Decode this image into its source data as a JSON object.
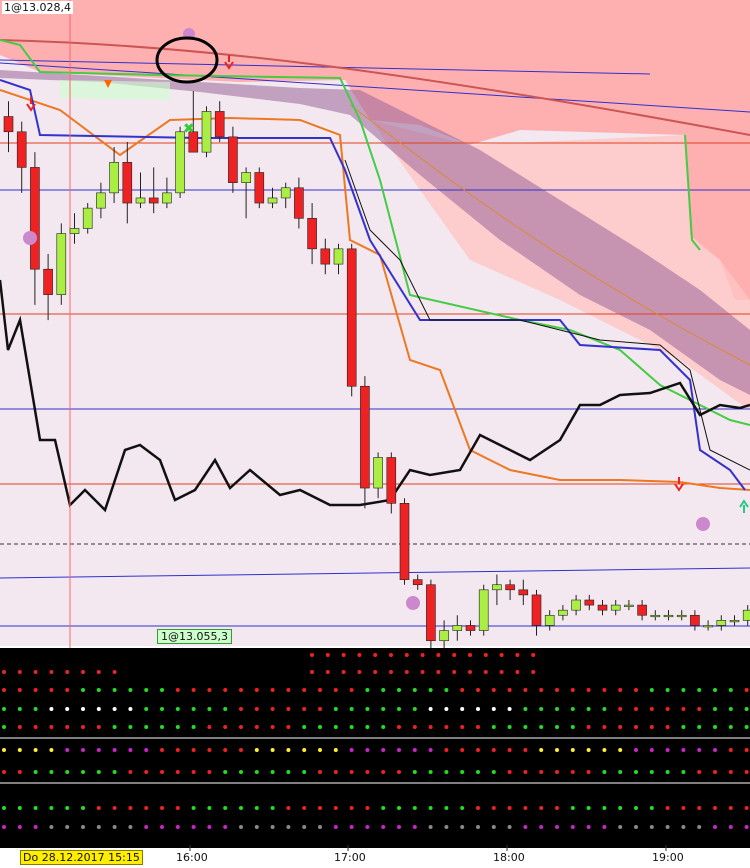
{
  "window": {
    "top_price_label": "1@13.028,4",
    "cursor_price_label": "1@13.055,3",
    "date_badge": "Do 28.12.2017 15:15"
  },
  "time_axis": {
    "ticks": [
      "16:00",
      "17:00",
      "18:00",
      "19:00"
    ]
  },
  "colors": {
    "bull_candle": "#aaee44",
    "bear_candle": "#ee2222",
    "cloud_pink": "#ffaaaa",
    "cloud_purple": "#996699",
    "indicator_panel_bg": "#000000",
    "date_badge_bg": "#ffee00"
  },
  "annotations": {
    "circle_mark": "hand-drawn-circle-annotation"
  },
  "chart_data": {
    "type": "candlestick",
    "x_ticks": [
      "16:00",
      "17:00",
      "18:00",
      "19:00"
    ],
    "interval_minutes": 5,
    "candles": [
      {
        "o": 0.95,
        "h": 0.98,
        "l": 0.88,
        "c": 0.92
      },
      {
        "o": 0.92,
        "h": 0.94,
        "l": 0.8,
        "c": 0.85
      },
      {
        "o": 0.85,
        "h": 0.88,
        "l": 0.58,
        "c": 0.65
      },
      {
        "o": 0.65,
        "h": 0.68,
        "l": 0.55,
        "c": 0.6
      },
      {
        "o": 0.6,
        "h": 0.74,
        "l": 0.58,
        "c": 0.72
      },
      {
        "o": 0.72,
        "h": 0.76,
        "l": 0.7,
        "c": 0.73
      },
      {
        "o": 0.73,
        "h": 0.78,
        "l": 0.72,
        "c": 0.77
      },
      {
        "o": 0.77,
        "h": 0.82,
        "l": 0.75,
        "c": 0.8
      },
      {
        "o": 0.8,
        "h": 0.89,
        "l": 0.78,
        "c": 0.86
      },
      {
        "o": 0.86,
        "h": 0.9,
        "l": 0.74,
        "c": 0.78
      },
      {
        "o": 0.78,
        "h": 0.84,
        "l": 0.77,
        "c": 0.79
      },
      {
        "o": 0.79,
        "h": 0.85,
        "l": 0.76,
        "c": 0.78
      },
      {
        "o": 0.78,
        "h": 0.83,
        "l": 0.77,
        "c": 0.8
      },
      {
        "o": 0.8,
        "h": 0.93,
        "l": 0.79,
        "c": 0.92
      },
      {
        "o": 0.92,
        "h": 1.0,
        "l": 0.88,
        "c": 0.88
      },
      {
        "o": 0.88,
        "h": 0.97,
        "l": 0.87,
        "c": 0.96
      },
      {
        "o": 0.96,
        "h": 0.98,
        "l": 0.9,
        "c": 0.91
      },
      {
        "o": 0.91,
        "h": 0.93,
        "l": 0.8,
        "c": 0.82
      },
      {
        "o": 0.82,
        "h": 0.85,
        "l": 0.75,
        "c": 0.84
      },
      {
        "o": 0.84,
        "h": 0.85,
        "l": 0.77,
        "c": 0.78
      },
      {
        "o": 0.78,
        "h": 0.81,
        "l": 0.77,
        "c": 0.79
      },
      {
        "o": 0.79,
        "h": 0.82,
        "l": 0.77,
        "c": 0.81
      },
      {
        "o": 0.81,
        "h": 0.83,
        "l": 0.73,
        "c": 0.75
      },
      {
        "o": 0.75,
        "h": 0.78,
        "l": 0.66,
        "c": 0.69
      },
      {
        "o": 0.69,
        "h": 0.71,
        "l": 0.64,
        "c": 0.66
      },
      {
        "o": 0.66,
        "h": 0.7,
        "l": 0.64,
        "c": 0.69
      },
      {
        "o": 0.69,
        "h": 0.7,
        "l": 0.4,
        "c": 0.42
      },
      {
        "o": 0.42,
        "h": 0.44,
        "l": 0.18,
        "c": 0.22
      },
      {
        "o": 0.22,
        "h": 0.29,
        "l": 0.2,
        "c": 0.28
      },
      {
        "o": 0.28,
        "h": 0.29,
        "l": 0.17,
        "c": 0.19
      },
      {
        "o": 0.19,
        "h": 0.2,
        "l": 0.03,
        "c": 0.04
      },
      {
        "o": 0.04,
        "h": 0.05,
        "l": 0.02,
        "c": 0.03
      },
      {
        "o": 0.03,
        "h": 0.04,
        "l": -0.12,
        "c": -0.08
      },
      {
        "o": -0.08,
        "h": -0.04,
        "l": -0.1,
        "c": -0.06
      },
      {
        "o": -0.06,
        "h": -0.03,
        "l": -0.08,
        "c": -0.05
      },
      {
        "o": -0.05,
        "h": -0.04,
        "l": -0.07,
        "c": -0.06
      },
      {
        "o": -0.06,
        "h": 0.03,
        "l": -0.07,
        "c": 0.02
      },
      {
        "o": 0.02,
        "h": 0.05,
        "l": -0.01,
        "c": 0.03
      },
      {
        "o": 0.03,
        "h": 0.04,
        "l": 0.0,
        "c": 0.02
      },
      {
        "o": 0.02,
        "h": 0.04,
        "l": -0.01,
        "c": 0.01
      },
      {
        "o": 0.01,
        "h": 0.02,
        "l": -0.07,
        "c": -0.05
      },
      {
        "o": -0.05,
        "h": -0.02,
        "l": -0.06,
        "c": -0.03
      },
      {
        "o": -0.03,
        "h": -0.01,
        "l": -0.04,
        "c": -0.02
      },
      {
        "o": -0.02,
        "h": 0.01,
        "l": -0.03,
        "c": 0.0
      },
      {
        "o": 0.0,
        "h": 0.01,
        "l": -0.02,
        "c": -0.01
      },
      {
        "o": -0.01,
        "h": 0.0,
        "l": -0.03,
        "c": -0.02
      },
      {
        "o": -0.02,
        "h": 0.0,
        "l": -0.03,
        "c": -0.01
      },
      {
        "o": -0.01,
        "h": 0.0,
        "l": -0.02,
        "c": -0.01
      },
      {
        "o": -0.01,
        "h": 0.0,
        "l": -0.04,
        "c": -0.03
      },
      {
        "o": -0.03,
        "h": -0.02,
        "l": -0.04,
        "c": -0.03
      },
      {
        "o": -0.03,
        "h": -0.02,
        "l": -0.04,
        "c": -0.03
      },
      {
        "o": -0.03,
        "h": -0.02,
        "l": -0.04,
        "c": -0.03
      },
      {
        "o": -0.03,
        "h": -0.02,
        "l": -0.06,
        "c": -0.05
      },
      {
        "o": -0.05,
        "h": -0.04,
        "l": -0.06,
        "c": -0.05
      },
      {
        "o": -0.05,
        "h": -0.03,
        "l": -0.06,
        "c": -0.04
      },
      {
        "o": -0.04,
        "h": -0.03,
        "l": -0.05,
        "c": -0.04
      },
      {
        "o": -0.04,
        "h": -0.01,
        "l": -0.05,
        "c": -0.02
      }
    ]
  }
}
